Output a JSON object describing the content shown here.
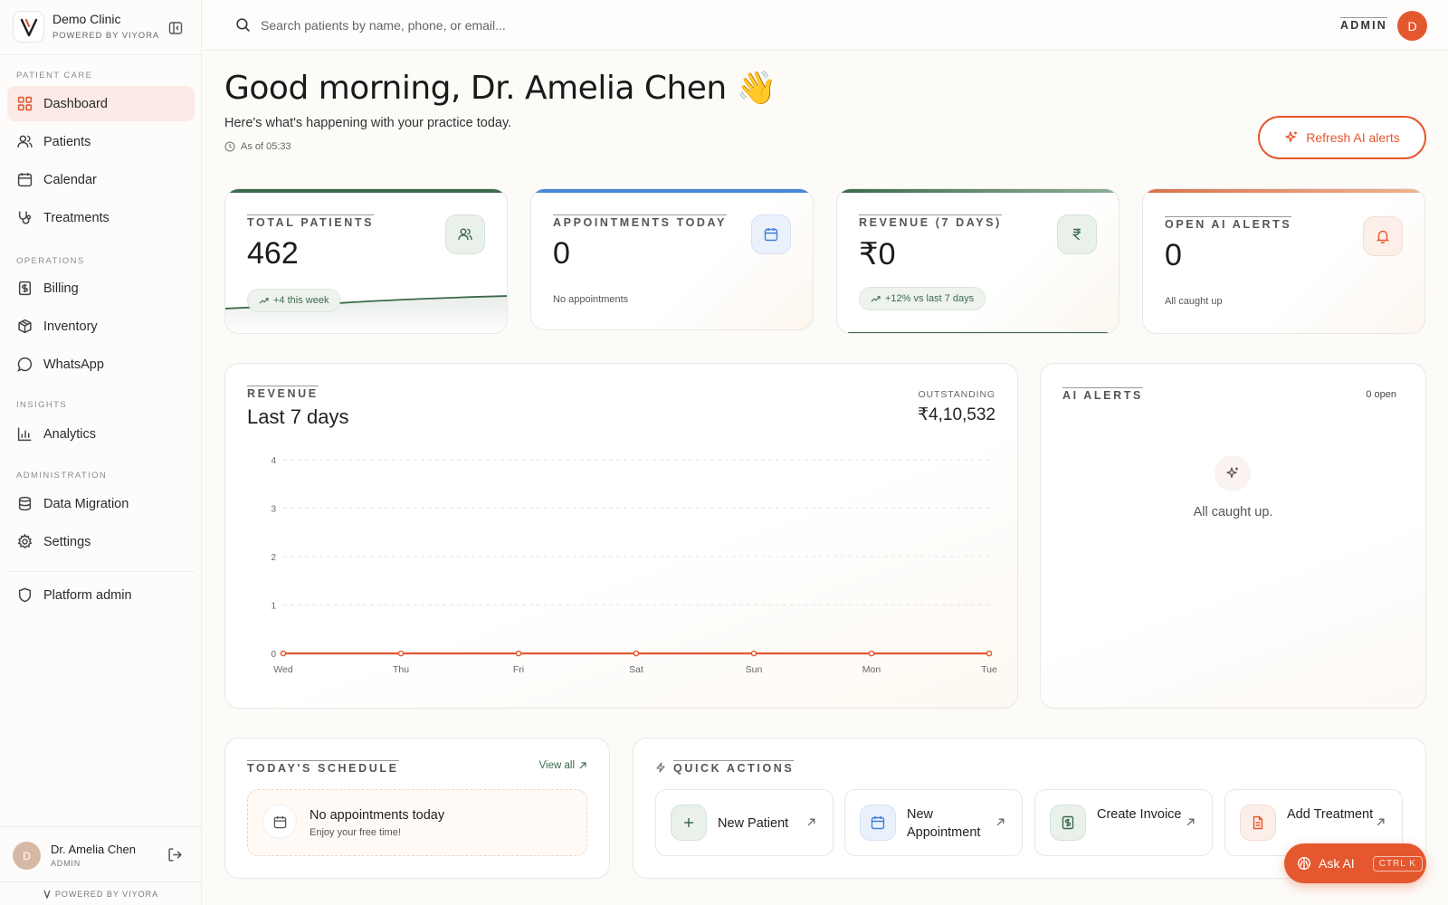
{
  "sidebar": {
    "clinic_name": "Demo Clinic",
    "clinic_sub": "POWERED BY VIYORA",
    "sections": {
      "patient_care": "PATIENT CARE",
      "operations": "OPERATIONS",
      "insights": "INSIGHTS",
      "administration": "ADMINISTRATION"
    },
    "items": {
      "dashboard": "Dashboard",
      "patients": "Patients",
      "calendar": "Calendar",
      "treatments": "Treatments",
      "billing": "Billing",
      "inventory": "Inventory",
      "whatsapp": "WhatsApp",
      "analytics": "Analytics",
      "data_migration": "Data Migration",
      "settings": "Settings",
      "platform_admin": "Platform admin"
    },
    "active_item": "dashboard",
    "user": {
      "initial": "D",
      "name": "Dr. Amelia Chen",
      "role": "ADMIN"
    },
    "footer": "POWERED BY VIYORA"
  },
  "topbar": {
    "search_placeholder": "Search patients by name, phone, or email...",
    "role_label": "ADMIN",
    "avatar_initial": "D"
  },
  "header": {
    "greeting": "Good morning, Dr. Amelia Chen 👋",
    "subtitle": "Here's what's happening with your practice today.",
    "as_of": "As of 05:33",
    "refresh_button": "Refresh AI alerts"
  },
  "stats": {
    "total_patients": {
      "label": "TOTAL PATIENTS",
      "value": "462",
      "note": "+4 this week"
    },
    "appointments_today": {
      "label": "APPOINTMENTS TODAY",
      "value": "0",
      "note": "No appointments"
    },
    "revenue_7_days": {
      "label": "REVENUE (7 DAYS)",
      "value": "₹0",
      "note": "+12% vs last 7 days"
    },
    "open_ai_alerts": {
      "label": "OPEN AI ALERTS",
      "value": "0",
      "note": "All caught up"
    }
  },
  "revenue_card": {
    "label": "REVENUE",
    "title": "Last 7 days",
    "outstanding_label": "OUTSTANDING",
    "outstanding_value": "₹4,10,532"
  },
  "chart_data": {
    "type": "line",
    "categories": [
      "Wed",
      "Thu",
      "Fri",
      "Sat",
      "Sun",
      "Mon",
      "Tue"
    ],
    "series": [
      {
        "values": [
          0,
          0,
          0,
          0,
          0,
          0,
          0
        ],
        "color": "#e5572f"
      }
    ],
    "y_ticks": [
      0,
      1,
      2,
      3,
      4
    ],
    "ylim": [
      0,
      4
    ],
    "grid": true
  },
  "ai_alerts": {
    "label": "AI ALERTS",
    "count": "0 open",
    "empty_text": "All caught up."
  },
  "schedule": {
    "label": "TODAY'S SCHEDULE",
    "view_all": "View all",
    "empty_title": "No appointments today",
    "empty_sub": "Enjoy your free time!"
  },
  "quick_actions": {
    "label": "QUICK ACTIONS",
    "new_patient": "New Patient",
    "new_appointment": "New Appointment",
    "create_invoice": "Create Invoice",
    "add_treatment": "Add Treatment"
  },
  "ask_ai": {
    "label": "Ask AI",
    "shortcut": "CTRL K"
  },
  "colors": {
    "accent": "#e5572f",
    "green": "#3c6a4b",
    "blue": "#3f7fd8",
    "active_bg": "#fbeae6"
  }
}
